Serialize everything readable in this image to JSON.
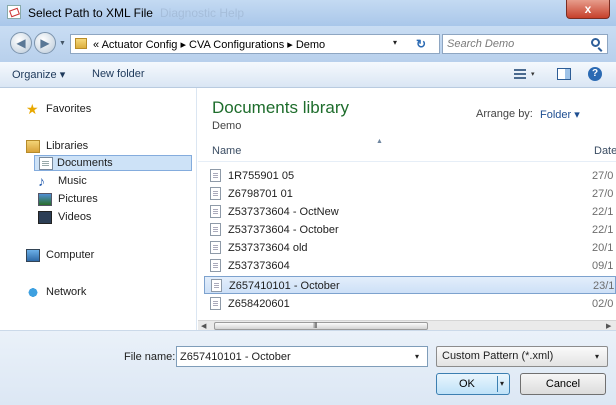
{
  "window": {
    "title": "Select Path to XML File",
    "title_ghost": "Diagnostic   Help",
    "close_label": "x"
  },
  "address": {
    "breadcrumb": "« Actuator Config ▸ CVA Configurations ▸ Demo",
    "dropdown_glyph": "▾",
    "refresh_glyph": "↻",
    "search_placeholder": "Search Demo"
  },
  "nav_buttons": {
    "back_glyph": "◀",
    "forward_glyph": "▶",
    "history_glyph": "▼"
  },
  "toolbar": {
    "organize_label": "Organize ▾",
    "new_folder_label": "New folder",
    "view_dropdown_glyph": "▾",
    "help_glyph": "?"
  },
  "sidebar": {
    "items": [
      {
        "label": "Favorites",
        "icon": "star-icon"
      },
      {
        "label": "Libraries",
        "icon": "libraries-icon"
      },
      {
        "label": "Documents",
        "icon": "documents-icon",
        "selected": true
      },
      {
        "label": "Music",
        "icon": "music-icon"
      },
      {
        "label": "Pictures",
        "icon": "pictures-icon"
      },
      {
        "label": "Videos",
        "icon": "videos-icon"
      },
      {
        "label": "Computer",
        "icon": "computer-icon"
      },
      {
        "label": "Network",
        "icon": "network-icon"
      }
    ]
  },
  "library": {
    "title": "Documents library",
    "subtitle": "Demo",
    "arrange_label": "Arrange by:",
    "arrange_value": "Folder ▾"
  },
  "columns": {
    "name": "Name",
    "date": "Date",
    "sort_glyph": "▲"
  },
  "files": [
    {
      "name": "1R755901 05",
      "date": "27/0"
    },
    {
      "name": "Z6798701 01",
      "date": "27/0"
    },
    {
      "name": "Z537373604 - OctNew",
      "date": "22/1"
    },
    {
      "name": "Z537373604 - October",
      "date": "22/1"
    },
    {
      "name": "Z537373604 old",
      "date": "20/1"
    },
    {
      "name": "Z537373604",
      "date": "09/1"
    },
    {
      "name": "Z657410101 - October",
      "date": "23/1",
      "selected": true
    },
    {
      "name": "Z658420601",
      "date": "02/0"
    }
  ],
  "scrollbar": {
    "left_glyph": "◀",
    "right_glyph": "▶",
    "thumb_grip": "III"
  },
  "footer": {
    "filename_label": "File name:",
    "filename_value": "Z657410101 - October",
    "filename_dropdown_glyph": "▾",
    "filter_value": "Custom Pattern (*.xml)",
    "filter_dropdown_glyph": "▾",
    "ok_label": "OK",
    "ok_arrow_glyph": "▾",
    "cancel_label": "Cancel"
  },
  "colors": {
    "title_bar": "#b8d1ee",
    "close_button": "#c6402b",
    "library_title": "#1e6d2c",
    "selection": "#cde2f7",
    "link": "#1e4e91"
  }
}
